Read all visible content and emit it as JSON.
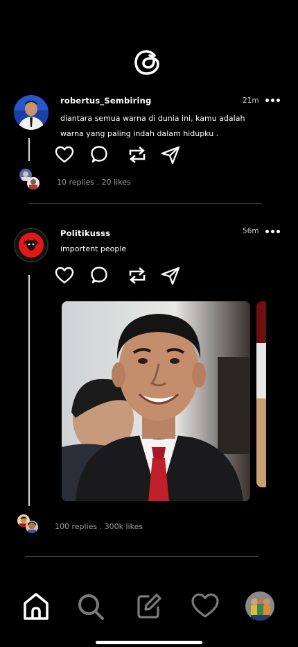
{
  "app": {
    "name": "Threads"
  },
  "posts": [
    {
      "username": "robertus_Sembiring",
      "time": "21m",
      "text": "diantara semua warna di dunia ini, kamu adalah warna yang paling indah dalam hidupku .",
      "stats": "10 replies . 20 likes"
    },
    {
      "username": "Politikusss",
      "time": "56m",
      "text": "importent people",
      "stats": "100 replies . 300k likes"
    }
  ],
  "nav": {
    "items": [
      "home-icon",
      "search-icon",
      "compose-icon",
      "activity-heart-icon",
      "profile-avatar"
    ]
  },
  "colors": {
    "background": "#000000",
    "text": "#ffffff",
    "muted": "#9a9a9a",
    "divider": "#4a4a4a"
  }
}
